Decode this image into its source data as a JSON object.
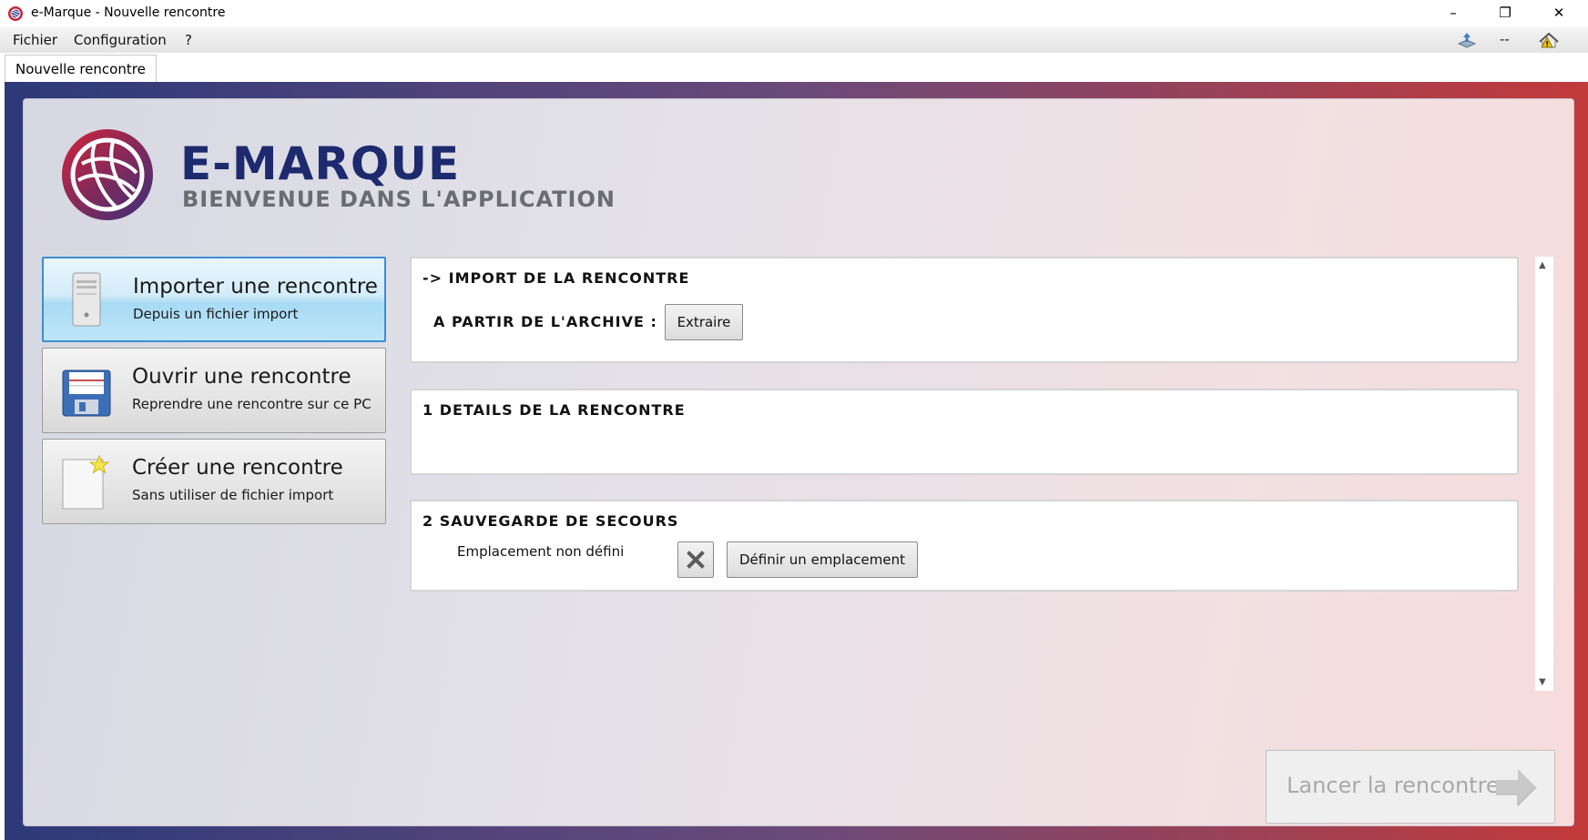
{
  "window": {
    "title": "e-Marque - Nouvelle rencontre",
    "minimize_glyph": "–",
    "maximize_glyph": "❐",
    "close_glyph": "✕"
  },
  "menu": {
    "items": [
      "Fichier",
      "Configuration",
      "?"
    ],
    "status_dash": "--"
  },
  "tabs": [
    {
      "label": "Nouvelle rencontre",
      "active": true
    }
  ],
  "brand": {
    "title": "E-MARQUE",
    "subtitle": "BIENVENUE DANS L'APPLICATION"
  },
  "actions": [
    {
      "title": "Importer une rencontre",
      "subtitle": "Depuis un fichier import",
      "icon": "computer-tower-icon",
      "selected": true
    },
    {
      "title": "Ouvrir une rencontre",
      "subtitle": "Reprendre une rencontre sur ce PC",
      "icon": "floppy-disk-icon",
      "selected": false
    },
    {
      "title": "Créer une rencontre",
      "subtitle": "Sans utiliser de fichier import",
      "icon": "new-document-icon",
      "selected": false
    }
  ],
  "sections": {
    "import": {
      "heading": "->  IMPORT DE LA RENCONTRE",
      "archive_label": "A PARTIR DE L'ARCHIVE :",
      "extract_button": "Extraire"
    },
    "details": {
      "heading": "1  DETAILS DE LA RENCONTRE"
    },
    "backup": {
      "heading": "2  SAUVEGARDE DE SECOURS",
      "location_status": "Emplacement non défini",
      "define_button": "Définir un emplacement"
    }
  },
  "launch": {
    "label": "Lancer la rencontre",
    "enabled": false
  },
  "colors": {
    "brand_blue": "#1d2a6e",
    "brand_red": "#c2263a",
    "selected_blue": "#a8dbf5"
  }
}
